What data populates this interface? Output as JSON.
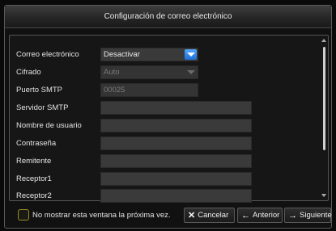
{
  "dialog": {
    "title": "Configuración de correo electrónico"
  },
  "form": {
    "fields": [
      {
        "label": "Correo electrónico",
        "value": "Desactivar",
        "kind": "dropdown",
        "enabled": true
      },
      {
        "label": "Cifrado",
        "value": "Auto",
        "kind": "dropdown",
        "enabled": false
      },
      {
        "label": "Puerto SMTP",
        "value": "00025",
        "kind": "text",
        "enabled": false
      },
      {
        "label": "Servidor SMTP",
        "value": "",
        "kind": "text",
        "enabled": true
      },
      {
        "label": "Nombre de usuario",
        "value": "",
        "kind": "text",
        "enabled": true
      },
      {
        "label": "Contraseña",
        "value": "",
        "kind": "text",
        "enabled": true
      },
      {
        "label": "Remitente",
        "value": "",
        "kind": "text",
        "enabled": true
      },
      {
        "label": "Receptor1",
        "value": "",
        "kind": "text",
        "enabled": true
      },
      {
        "label": "Receptor2",
        "value": "",
        "kind": "text",
        "enabled": true
      }
    ]
  },
  "footer": {
    "checkbox_label": "No mostrar esta ventana la próxima vez.",
    "checkbox_checked": false,
    "cancel_label": "Cancelar",
    "cancel_icon": "close-icon",
    "back_label": "Anterior",
    "back_icon": "arrow-left-icon",
    "next_label": "Siguiente",
    "next_icon": "arrow-right-icon"
  },
  "colors": {
    "accent_dropdown": "#1e6fd6",
    "checkbox_border": "#9a8a2a"
  }
}
